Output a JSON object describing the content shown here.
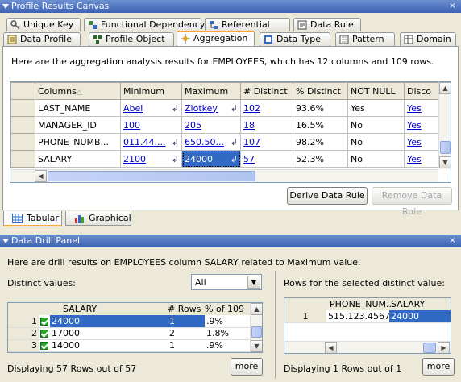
{
  "canvas": {
    "title": "Profile Results Canvas",
    "close": "×"
  },
  "tabs_row1": [
    {
      "label": "Unique Key",
      "icon": "unique-key-icon"
    },
    {
      "label": "Functional Dependency",
      "icon": "functional-dependency-icon"
    },
    {
      "label": "Referential",
      "icon": "referential-icon"
    },
    {
      "label": "Data Rule",
      "icon": "data-rule-icon"
    }
  ],
  "tabs_row2": [
    {
      "label": "Data Profile",
      "icon": "data-profile-icon"
    },
    {
      "label": "Profile Object",
      "icon": "profile-object-icon"
    },
    {
      "label": "Aggregation",
      "icon": "aggregation-icon",
      "active": true
    },
    {
      "label": "Data Type",
      "icon": "data-type-icon"
    },
    {
      "label": "Pattern",
      "icon": "pattern-icon"
    },
    {
      "label": "Domain",
      "icon": "domain-icon"
    }
  ],
  "aggregation": {
    "summary": "Here are the aggregation analysis results for EMPLOYEES, which has 12 columns and 109 rows.",
    "headers": [
      "Columns",
      "Minimum",
      "Maximum",
      "# Distinct",
      "% Distinct",
      "NOT NULL",
      "Disco"
    ],
    "rows": [
      {
        "column": "LAST_NAME",
        "min": "Abel",
        "max": "Zlotkey",
        "distinct": "102",
        "pct": "93.6%",
        "notnull": "Yes",
        "disc": "Yes"
      },
      {
        "column": "MANAGER_ID",
        "min": "100",
        "max": "205",
        "distinct": "18",
        "pct": "16.5%",
        "notnull": "No",
        "disc": "Yes"
      },
      {
        "column": "PHONE_NUMB...",
        "min": "011.44....",
        "max": "650.50...",
        "distinct": "107",
        "pct": "98.2%",
        "notnull": "No",
        "disc": "Yes"
      },
      {
        "column": "SALARY",
        "min": "2100",
        "max": "24000",
        "distinct": "57",
        "pct": "52.3%",
        "notnull": "No",
        "disc": "Yes"
      }
    ],
    "derive_button": "Derive Data Rule",
    "remove_button": "Remove Data Rule"
  },
  "view_tabs": [
    {
      "label": "Tabular",
      "icon": "table-icon",
      "active": true
    },
    {
      "label": "Graphical",
      "icon": "chart-icon"
    }
  ],
  "drill": {
    "title": "Data Drill Panel",
    "summary": "Here are drill results on EMPLOYEES column SALARY related to Maximum value.",
    "distinct_label": "Distinct values:",
    "filter_value": "All",
    "left_headers": [
      "SALARY",
      "# Rows",
      "% of 109"
    ],
    "left_rows": [
      {
        "n": "1",
        "value": "24000",
        "rows": "1",
        "pct": ".9%"
      },
      {
        "n": "2",
        "value": "17000",
        "rows": "2",
        "pct": "1.8%"
      },
      {
        "n": "3",
        "value": "14000",
        "rows": "1",
        "pct": ".9%"
      }
    ],
    "left_status": "Displaying 57 Rows out of 57",
    "more": "more",
    "right_label": "Rows for the selected distinct value:",
    "right_headers": [
      "PHONE_NUM...",
      "SALARY"
    ],
    "right_rows": [
      {
        "n": "1",
        "phone": "515.123.4567",
        "salary": "24000"
      }
    ],
    "right_status": "Displaying 1 Rows out of 1"
  }
}
